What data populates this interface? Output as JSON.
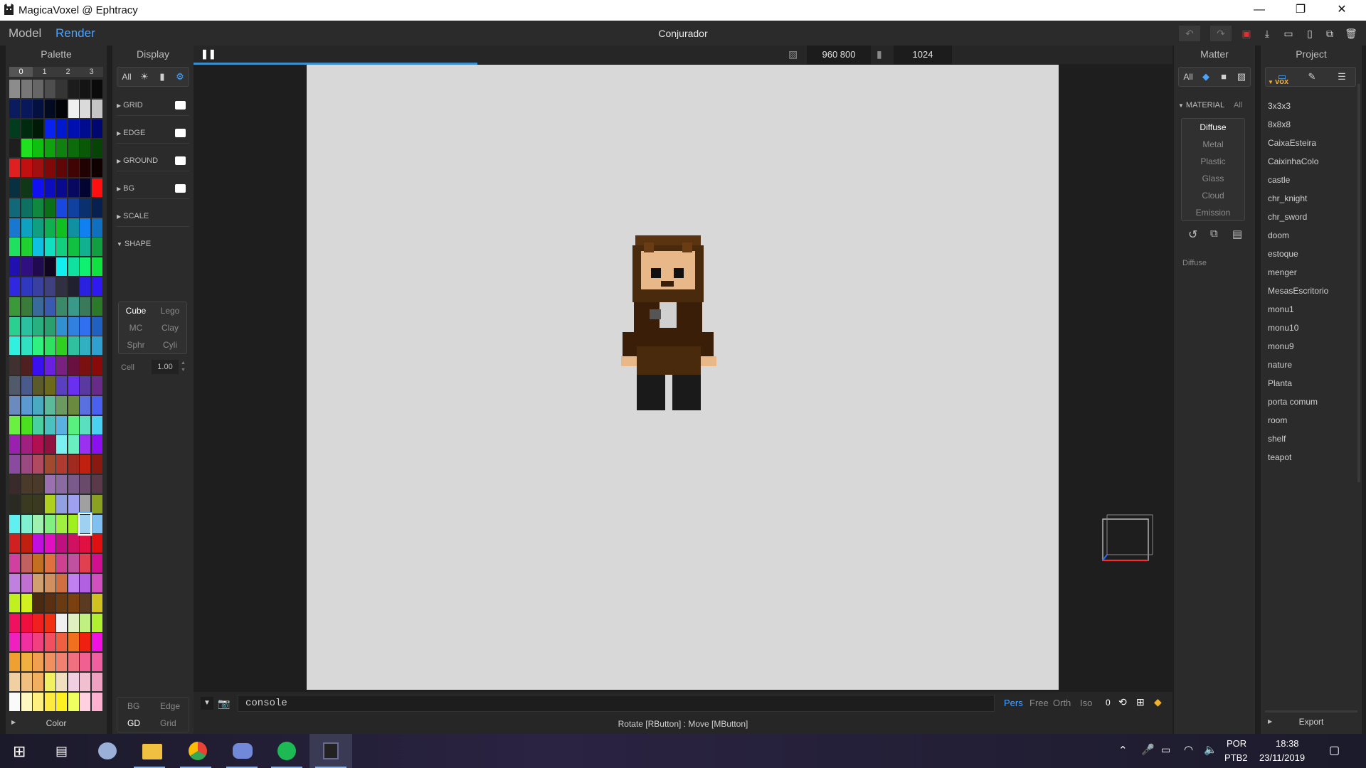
{
  "window": {
    "title": "MagicaVoxel @ Ephtracy",
    "minimize": "—",
    "restore": "❐",
    "close": "✕"
  },
  "header": {
    "modes": [
      {
        "label": "Model"
      },
      {
        "label": "Render"
      }
    ],
    "project_name": "Conjurador",
    "toolbar_icons": [
      "undo-icon",
      "redo-icon",
      "save-icon",
      "import-icon",
      "open-icon",
      "new-icon",
      "copy-icon",
      "delete-icon"
    ]
  },
  "palette": {
    "title": "Palette",
    "tabs": [
      "0",
      "1",
      "2",
      "3"
    ],
    "footer_label": "Color",
    "rows": [
      [
        "#8c8c8c",
        "#777777",
        "#666666",
        "#4e4e4e",
        "#353535",
        "#1c1c1c",
        "#141414",
        "#0a0a0a"
      ],
      [
        "#0b1b60",
        "#08185a",
        "#041040",
        "#040a20",
        "#020408",
        "#f0f0f0",
        "#dadada",
        "#c4c4c4"
      ],
      [
        "#003c1e",
        "#002a10",
        "#001a08",
        "#0a22f0",
        "#0018d0",
        "#0010b0",
        "#000c90",
        "#000870"
      ],
      [
        "#1e1e1e",
        "#20e020",
        "#10c010",
        "#10a010",
        "#108010",
        "#0c6c0c",
        "#085808",
        "#064406"
      ],
      [
        "#e02020",
        "#c01010",
        "#a01010",
        "#800808",
        "#600606",
        "#400404",
        "#200202",
        "#100101"
      ],
      [
        "#083040",
        "#103818",
        "#1010f0",
        "#0d0dc0",
        "#0a0a90",
        "#080860",
        "#040430",
        "#ff1010"
      ],
      [
        "#106878",
        "#0e7060",
        "#108840",
        "#0a7018",
        "#1848e0",
        "#1040a0",
        "#0a3070",
        "#082050"
      ],
      [
        "#1878d0",
        "#10a0c0",
        "#10a080",
        "#10b050",
        "#10c020",
        "#1090a0",
        "#1080f0",
        "#1070c0"
      ],
      [
        "#20e060",
        "#20d030",
        "#10c0e0",
        "#10e0c0",
        "#10d080",
        "#10c040",
        "#10b090",
        "#10a040"
      ],
      [
        "#2010b0",
        "#301080",
        "#200a50",
        "#100620",
        "#10f0f0",
        "#10e0a0",
        "#10f070",
        "#10e040"
      ],
      [
        "#3028e0",
        "#3038c0",
        "#3a40a0",
        "#404080",
        "#303040",
        "#202030",
        "#2a20e0",
        "#3018f0"
      ],
      [
        "#3a9a3a",
        "#3a7a3a",
        "#3a6a9a",
        "#3a5ab0",
        "#3a8a6a",
        "#3a9a8a",
        "#3a7a5a",
        "#2a7a2a"
      ],
      [
        "#2ad090",
        "#2ac0a0",
        "#2ab080",
        "#2aa070",
        "#3090d0",
        "#3080e0",
        "#3070f0",
        "#2060c0"
      ],
      [
        "#30f0e0",
        "#30e0c0",
        "#30f080",
        "#30e060",
        "#30d020",
        "#30c0a0",
        "#30b0c0",
        "#30a0d0"
      ],
      [
        "#403030",
        "#502020",
        "#3a10f0",
        "#6a20e0",
        "#7a2080",
        "#6a1040",
        "#7a1010",
        "#8a0a0a"
      ],
      [
        "#505a6a",
        "#4a5a8a",
        "#5a5a2a",
        "#6a6a1a",
        "#5a40c0",
        "#6a30f0",
        "#5a3aa0",
        "#6a2a8a"
      ],
      [
        "#6a8ac0",
        "#5a9ad0",
        "#4aaac0",
        "#5aba9a",
        "#6a9a60",
        "#6a8a40",
        "#5a70e0",
        "#4a60f0"
      ],
      [
        "#6af040",
        "#4ae020",
        "#4ad0a0",
        "#4ac0c0",
        "#5ab0e0",
        "#5af080",
        "#5ae0c0",
        "#4ad0f0"
      ],
      [
        "#9a20b0",
        "#a02080",
        "#b01050",
        "#901040",
        "#7af0f0",
        "#6af0c0",
        "#9a30f0",
        "#8a10f0"
      ],
      [
        "#8a4aa0",
        "#9a4a80",
        "#b04a60",
        "#a04a30",
        "#b03a30",
        "#a02a20",
        "#c02010",
        "#8a1a10"
      ],
      [
        "#3a2a2a",
        "#4a3a2a",
        "#4a3a2a",
        "#9a70b0",
        "#8a6aa0",
        "#7a5a8a",
        "#6a4a6a",
        "#5a3a4a"
      ],
      [
        "#2a2a20",
        "#3a3a20",
        "#3a3a20",
        "#b0d020",
        "#90a0e0",
        "#a0a0f0",
        "#a0a0a0",
        "#8aa020"
      ],
      [
        "#60f0f0",
        "#80f0d0",
        "#a0f0b0",
        "#80f080",
        "#a0f040",
        "#a0f020",
        "#a0d0f0",
        "#80c0f0"
      ],
      [
        "#d02020",
        "#c02010",
        "#c010e0",
        "#e010c0",
        "#c01080",
        "#d01060",
        "#e01040",
        "#e01010"
      ],
      [
        "#d040a0",
        "#c06060",
        "#c07020",
        "#e07040",
        "#d04090",
        "#c050a0",
        "#e04050",
        "#d01090"
      ],
      [
        "#c080e0",
        "#c070d0",
        "#d0a070",
        "#d09060",
        "#d07040",
        "#c080f0",
        "#b060e0",
        "#d050c0"
      ],
      [
        "#c0f020",
        "#d0f020",
        "#4a2a10",
        "#5a3010",
        "#6a3a10",
        "#7a4010",
        "#5a3a20",
        "#d0c020"
      ],
      [
        "#f01060",
        "#f01040",
        "#f02020",
        "#f03010",
        "#f0f0f0",
        "#e0f0c0",
        "#c0f080",
        "#b0f030"
      ],
      [
        "#f020c0",
        "#f030a0",
        "#f04080",
        "#f05060",
        "#f06040",
        "#f07020",
        "#f02010",
        "#f010e0"
      ],
      [
        "#f0a030",
        "#f0b040",
        "#f0a050",
        "#f09060",
        "#f08070",
        "#f07080",
        "#f06090",
        "#f060a0"
      ],
      [
        "#f0d0a0",
        "#f0c080",
        "#f0b060",
        "#f0f060",
        "#f0e0c0",
        "#f0d0e0",
        "#f0c0d0",
        "#f0a0c0"
      ],
      [
        "#fafafa",
        "#fff8c0",
        "#fff080",
        "#ffea40",
        "#fff020",
        "#f0ff60",
        "#ffd0e0",
        "#ffb0d0"
      ]
    ],
    "selected": {
      "row": 22,
      "col": 6
    }
  },
  "display": {
    "title": "Display",
    "filter_all": "All",
    "filter_icons": [
      "sun-icon",
      "chart-icon",
      "gear-icon"
    ],
    "sections": [
      {
        "label": "GRID",
        "toggle": true
      },
      {
        "label": "EDGE",
        "toggle": true
      },
      {
        "label": "GROUND",
        "toggle": true
      },
      {
        "label": "BG",
        "toggle": true
      },
      {
        "label": "SCALE",
        "toggle": false
      },
      {
        "label": "SHAPE",
        "toggle": false
      }
    ],
    "shapes": [
      "Cube",
      "Lego",
      "MC",
      "Clay",
      "Sphr",
      "Cyli"
    ],
    "active_shape": "Cube",
    "cell_label": "Cell",
    "cell_value": "1.00",
    "footer": [
      [
        "BG",
        "Edge"
      ],
      [
        "GD",
        "Grid"
      ]
    ]
  },
  "viewport": {
    "pause_icon": "pause-icon",
    "resolution": "960  800",
    "samples": "1024",
    "render_progress": 0.29,
    "console_placeholder": "console",
    "camera_modes": [
      "Pers",
      "Free",
      "Orth",
      "Iso"
    ],
    "active_camera": "Pers",
    "camera_value": "0",
    "status": "Rotate [RButton] : Move [MButton]"
  },
  "matter": {
    "title": "Matter",
    "filter_all": "All",
    "section": "MATERIAL",
    "section_filter": "All",
    "materials": [
      "Diffuse",
      "Metal",
      "Plastic",
      "Glass",
      "Cloud",
      "Emission"
    ],
    "active_material": "Diffuse",
    "current_label": "Diffuse"
  },
  "project": {
    "title": "Project",
    "folder": "vox",
    "files": [
      "3x3x3",
      "8x8x8",
      "CaixaEsteira",
      "CaixinhaColo",
      "castle",
      "chr_knight",
      "chr_sword",
      "doom",
      "estoque",
      "menger",
      "MesasEscritorio",
      "monu1",
      "monu10",
      "monu9",
      "nature",
      "Planta",
      "porta comum",
      "room",
      "shelf",
      "teapot"
    ],
    "export_label": "Export"
  },
  "taskbar": {
    "apps": [
      "windows-start-icon",
      "task-view-icon",
      "paint-icon",
      "file-explorer-icon",
      "chrome-icon",
      "discord-icon",
      "spotify-icon",
      "magicavoxel-icon"
    ],
    "lang_top": "POR",
    "lang_bottom": "PTB2",
    "time": "18:38",
    "date": "23/11/2019"
  },
  "colors": {
    "accent": "#4aa3ff",
    "panel": "#2b2b2b",
    "canvas": "#d8d8d8"
  }
}
